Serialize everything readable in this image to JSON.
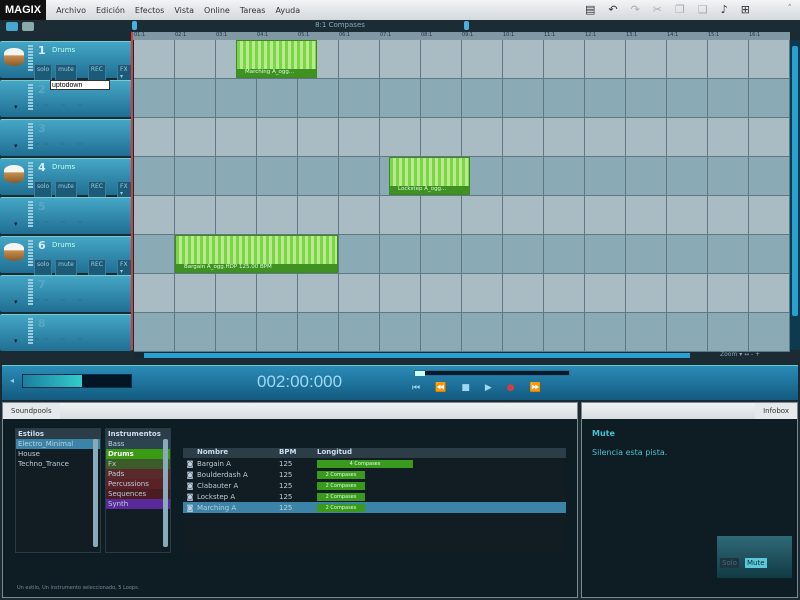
{
  "app": {
    "logo": "MAGIX"
  },
  "menu": [
    "Archivo",
    "Edición",
    "Efectos",
    "Vista",
    "Online",
    "Tareas",
    "Ayuda"
  ],
  "toolbar_icons": [
    "save-icon",
    "undo-icon",
    "redo-icon",
    "cut-icon",
    "copy-icon",
    "paste-icon",
    "metronome-icon",
    "mixer-icon"
  ],
  "arranger": {
    "bars_label": "8:1 Compases",
    "ruler": [
      "01:1",
      "02:1",
      "03:1",
      "04:1",
      "05:1",
      "06:1",
      "07:1",
      "08:1",
      "09:1",
      "10:1",
      "11:1",
      "12:1",
      "13:1",
      "14:1",
      "15:1",
      "16:1"
    ],
    "tracks": [
      {
        "num": "1",
        "name": "Drums",
        "solo": "solo",
        "mute": "mute",
        "rec": "REC",
        "fx": "FX ▾"
      },
      {
        "num": "2",
        "name": "",
        "rename_value": "uptodown"
      },
      {
        "num": "3",
        "name": ""
      },
      {
        "num": "4",
        "name": "Drums",
        "solo": "solo",
        "mute": "mute",
        "rec": "REC",
        "fx": "FX ▾"
      },
      {
        "num": "5",
        "name": ""
      },
      {
        "num": "6",
        "name": "Drums",
        "solo": "solo",
        "mute": "mute",
        "rec": "REC",
        "fx": "FX ▾"
      },
      {
        "num": "7",
        "name": ""
      },
      {
        "num": "8",
        "name": ""
      }
    ],
    "clips": [
      {
        "track": 1,
        "label": "Marching A_ogg..."
      },
      {
        "track": 4,
        "label": "Lockstep A_ogg..."
      },
      {
        "track": 6,
        "label": "Bargain A_ogg.HDP  125.00 BPM"
      }
    ],
    "zoom_label": "Zoom ▾  ↔  -  +"
  },
  "transport": {
    "time": "002:00:000",
    "volume_percent": 55,
    "position_percent": 6
  },
  "soundpools": {
    "tab": "Soundpools",
    "styles_header": "Estilos",
    "styles": [
      "Electro_Minimal",
      "House",
      "Techno_Trance"
    ],
    "instruments_header": "Instrumentos",
    "instruments": [
      {
        "name": "Bass",
        "color": "#2c4450"
      },
      {
        "name": "Drums",
        "color": "#3a9a12"
      },
      {
        "name": "Fx",
        "color": "#3d5a2a"
      },
      {
        "name": "Pads",
        "color": "#5a2a2a"
      },
      {
        "name": "Percussions",
        "color": "#5a2226"
      },
      {
        "name": "Sequences",
        "color": "#4a1c22"
      },
      {
        "name": "Synth",
        "color": "#5a2a9a"
      }
    ],
    "columns": [
      "Nombre",
      "BPM",
      "Longitud"
    ],
    "loops": [
      {
        "name": "Bargain A",
        "bpm": "125",
        "length": "4 Compases",
        "bars": 4
      },
      {
        "name": "Boulderdash A",
        "bpm": "125",
        "length": "2 Compases",
        "bars": 2
      },
      {
        "name": "Clabauter A",
        "bpm": "125",
        "length": "2 Compases",
        "bars": 2
      },
      {
        "name": "Lockstep A",
        "bpm": "125",
        "length": "2 Compases",
        "bars": 2
      },
      {
        "name": "Marching A",
        "bpm": "125",
        "length": "2 Compases",
        "bars": 2
      }
    ],
    "status": "Un estilo, Un instrumento seleccionado, 5 Loops."
  },
  "infobox": {
    "tab": "Infobox",
    "title": "Mute",
    "description": "Silencia esta pista.",
    "solo": "Solo",
    "mute": "Mute"
  }
}
